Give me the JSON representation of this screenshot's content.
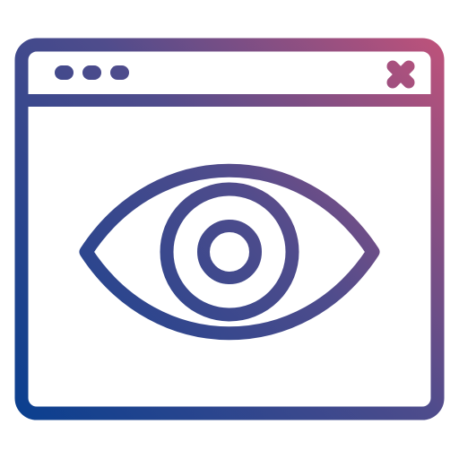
{
  "icon": {
    "name": "browser-window-eye-icon",
    "gradient": {
      "start_color": "#0a3f8f",
      "mid_color": "#4f4c8c",
      "end_color": "#c0527a"
    },
    "background_color": "#ffffff"
  },
  "window": {
    "title_bar_dots": [
      "dot-1",
      "dot-2",
      "dot-3"
    ],
    "close_glyph": "close-icon"
  },
  "content": {
    "symbol": "eye-icon"
  }
}
